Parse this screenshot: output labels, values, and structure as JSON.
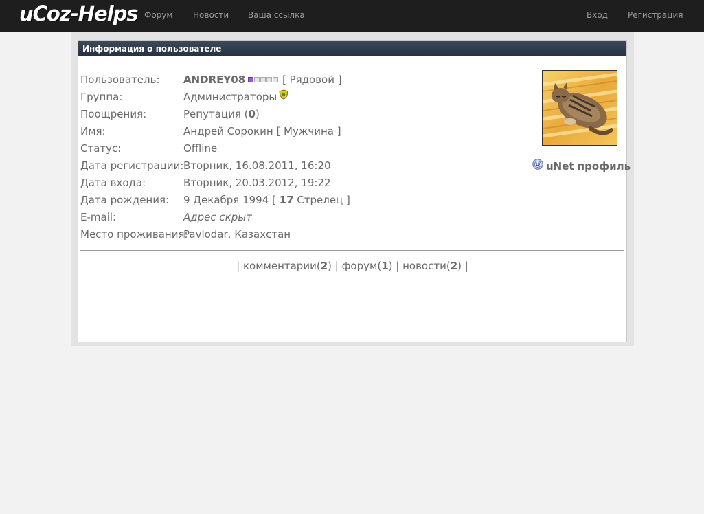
{
  "header": {
    "logo": "uCoz-Helps",
    "nav_left": [
      "Форум",
      "Новости",
      "Ваша ссылка"
    ],
    "nav_right": [
      "Вход",
      "Регистрация"
    ]
  },
  "panel": {
    "title": "Информация о пользователе"
  },
  "profile": {
    "rows": [
      {
        "label": "Пользователь:",
        "value": "ANDREY08",
        "rank_text": "[ Рядовой ]"
      },
      {
        "label": "Группа:",
        "value": "Администраторы"
      },
      {
        "label": "Поощрения:",
        "value_prefix": "Репутация (",
        "value_num": "0",
        "value_suffix": ")"
      },
      {
        "label": "Имя:",
        "value": "Андрей Сорокин [ Мужчина ]"
      },
      {
        "label": "Статус:",
        "value": "Offline"
      },
      {
        "label": "Дата регистрации:",
        "value": "Вторник, 16.08.2011, 16:20"
      },
      {
        "label": "Дата входа:",
        "value": "Вторник, 20.03.2012, 19:22"
      },
      {
        "label": "Дата рождения:",
        "value_prefix": "9 Декабря 1994 [ ",
        "value_num": "17",
        "value_suffix": " Стрелец ]"
      },
      {
        "label": "E-mail:",
        "value": "Адрес скрыт"
      },
      {
        "label": "Место проживания:",
        "value": "Pavlodar, Казахстан"
      }
    ],
    "rank_level": 1,
    "rank_max": 5,
    "unet_label": "uNet профиль"
  },
  "activity": {
    "sep": "|",
    "items": [
      {
        "label": "комментарии",
        "count": "2"
      },
      {
        "label": "форум",
        "count": "1"
      },
      {
        "label": "новости",
        "count": "2"
      }
    ]
  },
  "colors": {
    "topbar": "#1e1e1e",
    "panel_header": "#2f3b4b",
    "rank_on": "#9a5ad8"
  }
}
